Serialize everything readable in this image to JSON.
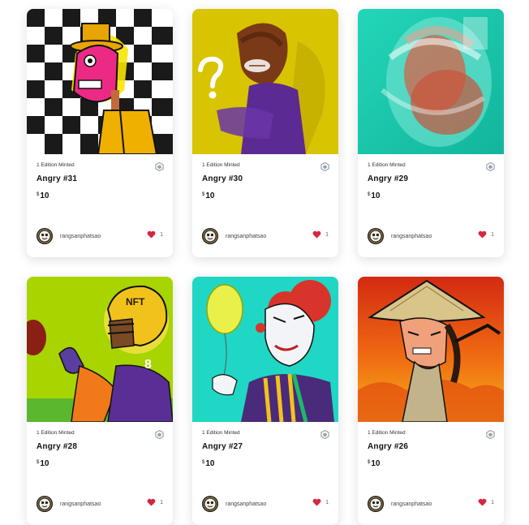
{
  "colors": {
    "heart": "#d7263d",
    "chain_icon": "#9aa3ad",
    "text_primary": "#111111"
  },
  "cards": [
    {
      "edition": "1 Edition Minted",
      "title": "Angry #31",
      "currency": "$",
      "price": "10",
      "owner": "rangsanphatsao",
      "likes": "1",
      "art": "angry-31-image"
    },
    {
      "edition": "1 Edition Minted",
      "title": "Angry #30",
      "currency": "$",
      "price": "10",
      "owner": "rangsanphatsao",
      "likes": "1",
      "art": "angry-30-image"
    },
    {
      "edition": "1 Edition Minted",
      "title": "Angry #29",
      "currency": "$",
      "price": "10",
      "owner": "rangsanphatsao",
      "likes": "1",
      "art": "angry-29-image"
    },
    {
      "edition": "1 Edition Minted",
      "title": "Angry #28",
      "currency": "$",
      "price": "10",
      "owner": "rangsanphatsao",
      "likes": "1",
      "art": "angry-28-image"
    },
    {
      "edition": "1 Edition Minted",
      "title": "Angry #27",
      "currency": "$",
      "price": "10",
      "owner": "rangsanphatsao",
      "likes": "1",
      "art": "angry-27-image"
    },
    {
      "edition": "1 Edition Minted",
      "title": "Angry #26",
      "currency": "$",
      "price": "10",
      "owner": "rangsanphatsao",
      "likes": "1",
      "art": "angry-26-image"
    }
  ]
}
